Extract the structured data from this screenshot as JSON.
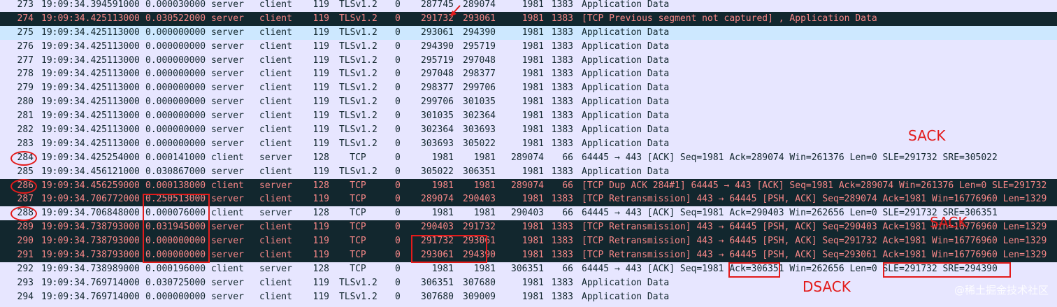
{
  "packets": [
    {
      "no": "273",
      "time": "19:09:34.394591000",
      "delta": "0.000030000",
      "src": "server",
      "dst": "client",
      "len": "119",
      "proto": "TLSv1.2",
      "z": "0",
      "seq": "287745",
      "nxt": "289074",
      "ack": "1981",
      "win": "1383",
      "info": "Application Data",
      "style": "normal"
    },
    {
      "no": "274",
      "time": "19:09:34.425113000",
      "delta": "0.030522000",
      "src": "server",
      "dst": "client",
      "len": "119",
      "proto": "TLSv1.2",
      "z": "0",
      "seq": "291732",
      "nxt": "293061",
      "ack": "1981",
      "win": "1383",
      "info": "[TCP Previous segment not captured] , Application Data",
      "style": "dark"
    },
    {
      "no": "275",
      "time": "19:09:34.425113000",
      "delta": "0.000000000",
      "src": "server",
      "dst": "client",
      "len": "119",
      "proto": "TLSv1.2",
      "z": "0",
      "seq": "293061",
      "nxt": "294390",
      "ack": "1981",
      "win": "1383",
      "info": "Application Data",
      "style": "sel"
    },
    {
      "no": "276",
      "time": "19:09:34.425113000",
      "delta": "0.000000000",
      "src": "server",
      "dst": "client",
      "len": "119",
      "proto": "TLSv1.2",
      "z": "0",
      "seq": "294390",
      "nxt": "295719",
      "ack": "1981",
      "win": "1383",
      "info": "Application Data",
      "style": "normal"
    },
    {
      "no": "277",
      "time": "19:09:34.425113000",
      "delta": "0.000000000",
      "src": "server",
      "dst": "client",
      "len": "119",
      "proto": "TLSv1.2",
      "z": "0",
      "seq": "295719",
      "nxt": "297048",
      "ack": "1981",
      "win": "1383",
      "info": "Application Data",
      "style": "normal"
    },
    {
      "no": "278",
      "time": "19:09:34.425113000",
      "delta": "0.000000000",
      "src": "server",
      "dst": "client",
      "len": "119",
      "proto": "TLSv1.2",
      "z": "0",
      "seq": "297048",
      "nxt": "298377",
      "ack": "1981",
      "win": "1383",
      "info": "Application Data",
      "style": "normal"
    },
    {
      "no": "279",
      "time": "19:09:34.425113000",
      "delta": "0.000000000",
      "src": "server",
      "dst": "client",
      "len": "119",
      "proto": "TLSv1.2",
      "z": "0",
      "seq": "298377",
      "nxt": "299706",
      "ack": "1981",
      "win": "1383",
      "info": "Application Data",
      "style": "normal"
    },
    {
      "no": "280",
      "time": "19:09:34.425113000",
      "delta": "0.000000000",
      "src": "server",
      "dst": "client",
      "len": "119",
      "proto": "TLSv1.2",
      "z": "0",
      "seq": "299706",
      "nxt": "301035",
      "ack": "1981",
      "win": "1383",
      "info": "Application Data",
      "style": "normal"
    },
    {
      "no": "281",
      "time": "19:09:34.425113000",
      "delta": "0.000000000",
      "src": "server",
      "dst": "client",
      "len": "119",
      "proto": "TLSv1.2",
      "z": "0",
      "seq": "301035",
      "nxt": "302364",
      "ack": "1981",
      "win": "1383",
      "info": "Application Data",
      "style": "normal"
    },
    {
      "no": "282",
      "time": "19:09:34.425113000",
      "delta": "0.000000000",
      "src": "server",
      "dst": "client",
      "len": "119",
      "proto": "TLSv1.2",
      "z": "0",
      "seq": "302364",
      "nxt": "303693",
      "ack": "1981",
      "win": "1383",
      "info": "Application Data",
      "style": "normal"
    },
    {
      "no": "283",
      "time": "19:09:34.425113000",
      "delta": "0.000000000",
      "src": "server",
      "dst": "client",
      "len": "119",
      "proto": "TLSv1.2",
      "z": "0",
      "seq": "303693",
      "nxt": "305022",
      "ack": "1981",
      "win": "1383",
      "info": "Application Data",
      "style": "normal"
    },
    {
      "no": "284",
      "time": "19:09:34.425254000",
      "delta": "0.000141000",
      "src": "client",
      "dst": "server",
      "len": "128",
      "proto": "TCP",
      "z": "0",
      "seq": "1981",
      "nxt": "1981",
      "ack": "289074",
      "win": "66",
      "info": "64445 → 443 [ACK] Seq=1981 Ack=289074 Win=261376 Len=0 SLE=291732 SRE=305022",
      "style": "normal"
    },
    {
      "no": "285",
      "time": "19:09:34.456121000",
      "delta": "0.030867000",
      "src": "server",
      "dst": "client",
      "len": "119",
      "proto": "TLSv1.2",
      "z": "0",
      "seq": "305022",
      "nxt": "306351",
      "ack": "1981",
      "win": "1383",
      "info": "Application Data",
      "style": "normal"
    },
    {
      "no": "286",
      "time": "19:09:34.456259000",
      "delta": "0.000138000",
      "src": "client",
      "dst": "server",
      "len": "128",
      "proto": "TCP",
      "z": "0",
      "seq": "1981",
      "nxt": "1981",
      "ack": "289074",
      "win": "66",
      "info": "[TCP Dup ACK 284#1] 64445 → 443 [ACK] Seq=1981 Ack=289074 Win=261376 Len=0 SLE=291732",
      "style": "dark"
    },
    {
      "no": "287",
      "time": "19:09:34.706772000",
      "delta": "0.250513000",
      "src": "server",
      "dst": "client",
      "len": "119",
      "proto": "TCP",
      "z": "0",
      "seq": "289074",
      "nxt": "290403",
      "ack": "1981",
      "win": "1383",
      "info": "[TCP Retransmission] 443 → 64445 [PSH, ACK] Seq=289074 Ack=1981 Win=16776960 Len=1329",
      "style": "dark"
    },
    {
      "no": "288",
      "time": "19:09:34.706848000",
      "delta": "0.000076000",
      "src": "client",
      "dst": "server",
      "len": "128",
      "proto": "TCP",
      "z": "0",
      "seq": "1981",
      "nxt": "1981",
      "ack": "290403",
      "win": "66",
      "info": "64445 → 443 [ACK] Seq=1981 Ack=290403 Win=262656 Len=0 SLE=291732 SRE=306351",
      "style": "normal"
    },
    {
      "no": "289",
      "time": "19:09:34.738793000",
      "delta": "0.031945000",
      "src": "server",
      "dst": "client",
      "len": "119",
      "proto": "TCP",
      "z": "0",
      "seq": "290403",
      "nxt": "291732",
      "ack": "1981",
      "win": "1383",
      "info": "[TCP Retransmission] 443 → 64445 [PSH, ACK] Seq=290403 Ack=1981 Win=16776960 Len=1329",
      "style": "dark"
    },
    {
      "no": "290",
      "time": "19:09:34.738793000",
      "delta": "0.000000000",
      "src": "server",
      "dst": "client",
      "len": "119",
      "proto": "TCP",
      "z": "0",
      "seq": "291732",
      "nxt": "293061",
      "ack": "1981",
      "win": "1383",
      "info": "[TCP Retransmission] 443 → 64445 [PSH, ACK] Seq=291732 Ack=1981 Win=16776960 Len=1329",
      "style": "dark"
    },
    {
      "no": "291",
      "time": "19:09:34.738793000",
      "delta": "0.000000000",
      "src": "server",
      "dst": "client",
      "len": "119",
      "proto": "TCP",
      "z": "0",
      "seq": "293061",
      "nxt": "294390",
      "ack": "1981",
      "win": "1383",
      "info": "[TCP Retransmission] 443 → 64445 [PSH, ACK] Seq=293061 Ack=1981 Win=16776960 Len=1329",
      "style": "dark"
    },
    {
      "no": "292",
      "time": "19:09:34.738989000",
      "delta": "0.000196000",
      "src": "client",
      "dst": "server",
      "len": "128",
      "proto": "TCP",
      "z": "0",
      "seq": "1981",
      "nxt": "1981",
      "ack": "306351",
      "win": "66",
      "info": "64445 → 443 [ACK] Seq=1981 Ack=306351 Win=262656 Len=0 SLE=291732 SRE=294390",
      "style": "normal"
    },
    {
      "no": "293",
      "time": "19:09:34.769714000",
      "delta": "0.030725000",
      "src": "server",
      "dst": "client",
      "len": "119",
      "proto": "TLSv1.2",
      "z": "0",
      "seq": "306351",
      "nxt": "307680",
      "ack": "1981",
      "win": "1383",
      "info": "Application Data",
      "style": "normal"
    },
    {
      "no": "294",
      "time": "19:09:34.769714000",
      "delta": "0.000000000",
      "src": "server",
      "dst": "client",
      "len": "119",
      "proto": "TLSv1.2",
      "z": "0",
      "seq": "307680",
      "nxt": "309009",
      "ack": "1981",
      "win": "1383",
      "info": "Application Data",
      "style": "normal"
    }
  ],
  "annotations": {
    "sack_top": "SACK",
    "sack_mid": "SACK",
    "dsack": "DSACK",
    "color": "#e31b1b"
  },
  "watermark": "@稀土掘金技术社区",
  "colors": {
    "background": "#e7e6ff",
    "dark_row_bg": "#12272e",
    "dark_row_text": "#f78787",
    "selected_row_bg": "#cde8ff"
  }
}
